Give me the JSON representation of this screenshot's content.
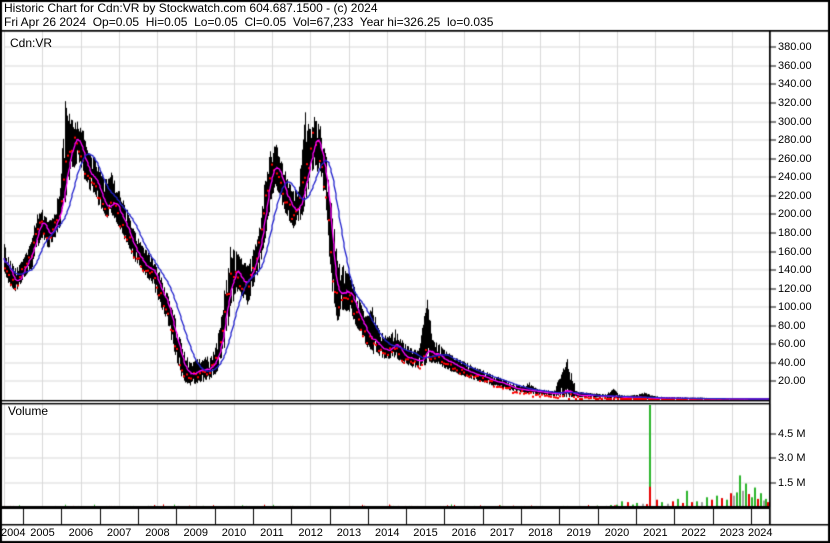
{
  "header": {
    "line1": "Historic Chart for Cdn:VR by Stockwatch.com 604.687.1500 - (c) 2024",
    "line2": "Fri Apr 26 2024  Op=0.05  Hi=0.05  Lo=0.05  Cl=0.05  Vol=67,233  Year hi=326.25  lo=0.035"
  },
  "price_pane": {
    "label": "Cdn:VR"
  },
  "volume_pane": {
    "label": "Volume"
  },
  "chart_data": [
    {
      "type": "ohlc",
      "title": "Cdn:VR",
      "x_axis": {
        "start_year": 2004,
        "end_year": 2024,
        "tick_labels": [
          "2004",
          "2005",
          "2006",
          "2007",
          "2008",
          "2009",
          "2010",
          "2011",
          "2012",
          "2013",
          "2014",
          "2015",
          "2016",
          "2017",
          "2018",
          "2019",
          "2020",
          "2021",
          "2022",
          "2023",
          "2024"
        ]
      },
      "y_axis": {
        "tick_labels": [
          "380.00",
          "360.00",
          "340.00",
          "320.00",
          "300.00",
          "280.00",
          "260.00",
          "240.00",
          "220.00",
          "200.00",
          "180.00",
          "160.00",
          "140.00",
          "120.00",
          "100.00",
          "80.00",
          "60.00",
          "40.00",
          "20.00"
        ],
        "tick_values": [
          380,
          360,
          340,
          320,
          300,
          280,
          260,
          240,
          220,
          200,
          180,
          160,
          140,
          120,
          100,
          80,
          60,
          40,
          20
        ],
        "range": [
          0,
          398
        ],
        "grid": true,
        "grid_color": "#d9d9d9"
      },
      "series": [
        {
          "name": "ohlc-bars",
          "color": "#000000",
          "anchors": [
            [
              2004.0,
              138,
              168,
              152
            ],
            [
              2004.15,
              122,
              150,
              133
            ],
            [
              2004.3,
              116,
              142,
              126
            ],
            [
              2004.5,
              128,
              152,
              142
            ],
            [
              2004.7,
              140,
              170,
              158
            ],
            [
              2004.85,
              163,
              200,
              186
            ],
            [
              2005.0,
              175,
              205,
              192
            ],
            [
              2005.15,
              163,
              192,
              176
            ],
            [
              2005.3,
              172,
              200,
              188
            ],
            [
              2005.45,
              185,
              228,
              205
            ],
            [
              2005.6,
              215,
              322,
              248
            ],
            [
              2005.75,
              248,
              302,
              278
            ],
            [
              2005.9,
              252,
              300,
              282
            ],
            [
              2006.05,
              242,
              290,
              262
            ],
            [
              2006.2,
              225,
              266,
              240
            ],
            [
              2006.35,
              222,
              262,
              238
            ],
            [
              2006.5,
              205,
              248,
              220
            ],
            [
              2006.65,
              195,
              238,
              205
            ],
            [
              2006.8,
              200,
              245,
              215
            ],
            [
              2007.0,
              185,
              225,
              200
            ],
            [
              2007.2,
              168,
              205,
              182
            ],
            [
              2007.4,
              148,
              182,
              160
            ],
            [
              2007.6,
              138,
              166,
              148
            ],
            [
              2007.85,
              125,
              155,
              138
            ],
            [
              2008.05,
              105,
              138,
              120
            ],
            [
              2008.25,
              85,
              115,
              98
            ],
            [
              2008.45,
              50,
              92,
              65
            ],
            [
              2008.65,
              22,
              55,
              34
            ],
            [
              2008.85,
              14,
              40,
              27
            ],
            [
              2009.05,
              18,
              44,
              30
            ],
            [
              2009.25,
              20,
              46,
              33
            ],
            [
              2009.45,
              24,
              52,
              38
            ],
            [
              2009.6,
              33,
              72,
              56
            ],
            [
              2009.75,
              58,
              118,
              92
            ],
            [
              2009.9,
              92,
              165,
              132
            ],
            [
              2010.05,
              118,
              160,
              140
            ],
            [
              2010.2,
              112,
              152,
              130
            ],
            [
              2010.35,
              102,
              145,
              125
            ],
            [
              2010.5,
              122,
              162,
              145
            ],
            [
              2010.65,
              138,
              182,
              165
            ],
            [
              2010.8,
              168,
              232,
              210
            ],
            [
              2010.95,
              212,
              268,
              248
            ],
            [
              2011.1,
              230,
              275,
              255
            ],
            [
              2011.25,
              212,
              255,
              230
            ],
            [
              2011.4,
              195,
              238,
              212
            ],
            [
              2011.55,
              185,
              225,
              202
            ],
            [
              2011.7,
              192,
              230,
              210
            ],
            [
              2011.85,
              205,
              310,
              235
            ],
            [
              2012.0,
              238,
              292,
              268
            ],
            [
              2012.1,
              252,
              305,
              285
            ],
            [
              2012.25,
              240,
              295,
              268
            ],
            [
              2012.4,
              210,
              262,
              232
            ],
            [
              2012.55,
              120,
              205,
              152
            ],
            [
              2012.7,
              85,
              150,
              110
            ],
            [
              2012.85,
              92,
              145,
              118
            ],
            [
              2013.0,
              95,
              135,
              115
            ],
            [
              2013.15,
              82,
              122,
              98
            ],
            [
              2013.3,
              72,
              105,
              85
            ],
            [
              2013.45,
              58,
              90,
              72
            ],
            [
              2013.6,
              50,
              100,
              62
            ],
            [
              2013.8,
              46,
              74,
              56
            ],
            [
              2014.0,
              43,
              68,
              53
            ],
            [
              2014.2,
              46,
              76,
              60
            ],
            [
              2014.4,
              40,
              63,
              48
            ],
            [
              2014.6,
              36,
              56,
              44
            ],
            [
              2014.8,
              33,
              53,
              41
            ],
            [
              2015.05,
              38,
              108,
              52
            ],
            [
              2015.2,
              40,
              64,
              53
            ],
            [
              2015.35,
              38,
              60,
              48
            ],
            [
              2015.5,
              34,
              54,
              43
            ],
            [
              2015.7,
              30,
              48,
              38
            ],
            [
              2015.9,
              27,
              43,
              34
            ],
            [
              2016.1,
              24,
              40,
              31
            ],
            [
              2016.3,
              21,
              35,
              27
            ],
            [
              2016.5,
              19,
              32,
              25
            ],
            [
              2016.7,
              16,
              28,
              21
            ],
            [
              2016.9,
              14,
              25,
              19
            ],
            [
              2017.1,
              11,
              21,
              16
            ],
            [
              2017.3,
              9,
              18,
              13
            ],
            [
              2017.5,
              8,
              15,
              11
            ],
            [
              2017.7,
              7,
              19,
              10
            ],
            [
              2017.9,
              6,
              12,
              9
            ],
            [
              2018.1,
              5,
              11,
              8
            ],
            [
              2018.35,
              4,
              10,
              7
            ],
            [
              2018.7,
              3,
              44,
              6
            ],
            [
              2018.95,
              3,
              9,
              5
            ],
            [
              2019.2,
              3,
              8,
              5
            ],
            [
              2019.45,
              2.5,
              7,
              4.5
            ],
            [
              2019.7,
              2,
              6,
              4
            ],
            [
              2019.9,
              2,
              12,
              3.5
            ],
            [
              2020.1,
              1.5,
              5,
              3
            ],
            [
              2020.4,
              1.5,
              5,
              3
            ],
            [
              2020.7,
              1,
              8,
              2.5
            ],
            [
              2021.0,
              1,
              4,
              2
            ],
            [
              2021.3,
              1,
              3,
              2
            ],
            [
              2021.6,
              0.8,
              3,
              1.7
            ],
            [
              2021.9,
              0.8,
              2.5,
              1.5
            ],
            [
              2022.2,
              0.7,
              2.5,
              1.4
            ],
            [
              2022.5,
              0.7,
              2,
              1.3
            ],
            [
              2022.8,
              0.6,
              2,
              1.2
            ],
            [
              2023.1,
              0.5,
              2,
              1.1
            ],
            [
              2023.4,
              0.5,
              1.8,
              1
            ],
            [
              2023.7,
              0.4,
              1.5,
              0.8
            ],
            [
              2024.0,
              0.05,
              1,
              0.3
            ]
          ]
        },
        {
          "name": "close-dots",
          "color": "#fe0000"
        },
        {
          "name": "ma-fast",
          "color": "#ff00ff",
          "window_bars": 10
        },
        {
          "name": "ma-slow",
          "color": "#2121cd",
          "window_bars": 34
        }
      ]
    },
    {
      "type": "bar",
      "title": "Volume",
      "y_axis": {
        "tick_labels": [
          "4.5 M",
          "3.0 M",
          "1.5 M"
        ],
        "tick_values": [
          4.5,
          3.0,
          1.5
        ],
        "unit": "millions of shares"
      },
      "colors": {
        "u": "#2cb52c",
        "d": "#e60000",
        "n": "#a0a0a0"
      },
      "baseline_noise": {
        "max": 0.07,
        "through_year": 2020.05
      },
      "bars": [
        [
          2019.85,
          0.12,
          "u"
        ],
        [
          2019.95,
          0.1,
          "d"
        ],
        [
          2020.0,
          0.14,
          "u"
        ],
        [
          2020.13,
          0.35,
          "u"
        ],
        [
          2020.29,
          0.3,
          "d"
        ],
        [
          2020.41,
          0.15,
          "u"
        ],
        [
          2020.53,
          0.25,
          "u"
        ],
        [
          2020.68,
          0.2,
          "n"
        ],
        [
          2020.78,
          0.18,
          "d"
        ],
        [
          2020.87,
          6.5,
          "u"
        ],
        [
          2020.87,
          1.25,
          "d"
        ],
        [
          2021.05,
          0.45,
          "d"
        ],
        [
          2021.18,
          0.3,
          "u"
        ],
        [
          2021.33,
          0.2,
          "n"
        ],
        [
          2021.46,
          0.35,
          "d"
        ],
        [
          2021.6,
          0.5,
          "u"
        ],
        [
          2021.73,
          0.25,
          "d"
        ],
        [
          2021.83,
          1.0,
          "u"
        ],
        [
          2021.96,
          0.3,
          "d"
        ],
        [
          2022.09,
          0.35,
          "u"
        ],
        [
          2022.23,
          0.3,
          "n"
        ],
        [
          2022.36,
          0.6,
          "u"
        ],
        [
          2022.49,
          0.45,
          "d"
        ],
        [
          2022.62,
          0.7,
          "u"
        ],
        [
          2022.75,
          0.55,
          "d"
        ],
        [
          2022.88,
          0.45,
          "u"
        ],
        [
          2022.98,
          0.85,
          "d"
        ],
        [
          2023.06,
          0.7,
          "n"
        ],
        [
          2023.14,
          0.9,
          "u"
        ],
        [
          2023.21,
          1.95,
          "u"
        ],
        [
          2023.29,
          1.0,
          "n"
        ],
        [
          2023.37,
          1.45,
          "u"
        ],
        [
          2023.45,
          0.8,
          "d"
        ],
        [
          2023.53,
          0.6,
          "u"
        ],
        [
          2023.6,
          1.2,
          "u"
        ],
        [
          2023.68,
          0.5,
          "d"
        ],
        [
          2023.76,
          0.85,
          "u"
        ],
        [
          2023.84,
          0.4,
          "n"
        ],
        [
          2023.89,
          0.5,
          "u"
        ],
        [
          2023.94,
          0.3,
          "d"
        ]
      ]
    }
  ]
}
